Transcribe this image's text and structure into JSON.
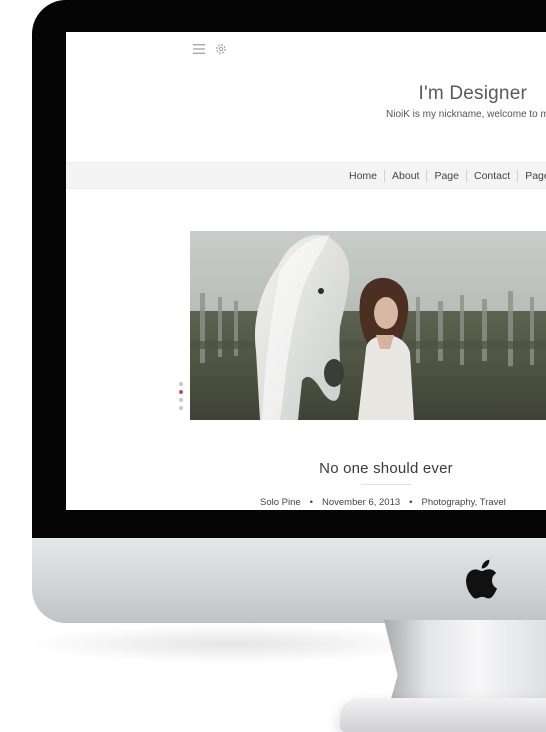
{
  "header": {
    "site_title": "I'm Designer",
    "tagline": "NioiK is my nickname,  welcome to my"
  },
  "icons": {
    "menu": "hamburger-menu-icon",
    "settings": "gear-icon",
    "brand": "apple-logo-icon"
  },
  "nav": {
    "items": [
      {
        "label": "Home"
      },
      {
        "label": "About"
      },
      {
        "label": "Page"
      },
      {
        "label": "Contact"
      },
      {
        "label": "Pages"
      }
    ]
  },
  "slider": {
    "dots": 4,
    "active_dot": 2
  },
  "post": {
    "title": "No one should ever",
    "author": "Solo Pine",
    "date": "November 6, 2013",
    "categories": "Photography, Travel"
  },
  "colors": {
    "accent": "#b5534f",
    "nav_bg": "#f4f4f4",
    "bezel": "#050505"
  }
}
